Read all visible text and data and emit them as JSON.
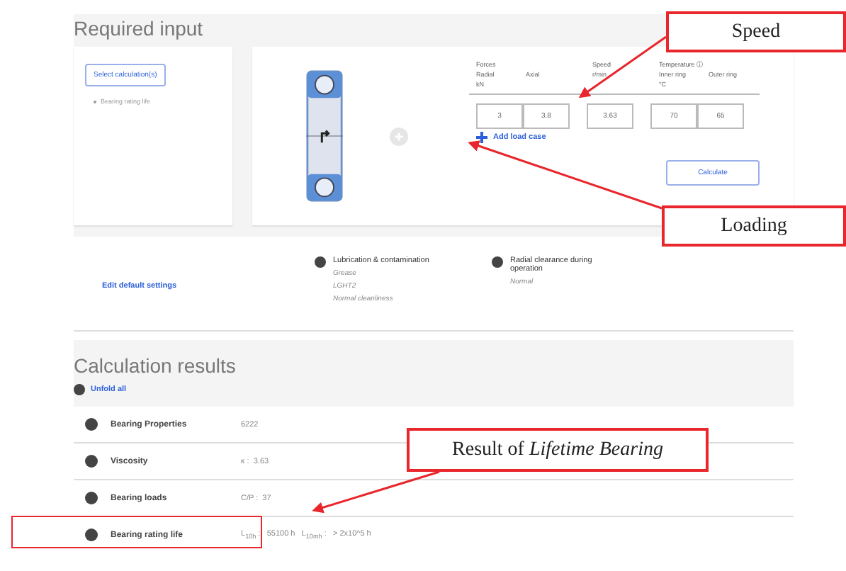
{
  "required_input": {
    "title": "Required input",
    "select_button": "Select calculation(s)",
    "selected_calculations": [
      "Bearing rating life"
    ],
    "load_table": {
      "groups": [
        {
          "label": "Forces",
          "columns": [
            {
              "label": "Radial",
              "unit": "kN",
              "value": "3"
            },
            {
              "label": "Axial",
              "value": "3.8"
            }
          ]
        },
        {
          "label": "Speed",
          "columns": [
            {
              "unit": "r/min",
              "value": "3.63"
            }
          ]
        },
        {
          "label": "Temperature ⓘ",
          "columns": [
            {
              "label": "Inner ring",
              "unit": "°C",
              "value": "70"
            },
            {
              "label": "Outer ring",
              "value": "65"
            }
          ]
        }
      ]
    },
    "add_load_case": "Add load case",
    "calculate_button": "Calculate"
  },
  "settings": {
    "edit_link": "Edit default settings",
    "groups": [
      {
        "title": "Lubrication & contamination",
        "values": [
          "Grease",
          "LGHT2",
          "Normal cleanliness"
        ]
      },
      {
        "title": "Radial clearance during operation",
        "values": [
          "Normal"
        ]
      }
    ]
  },
  "results": {
    "title": "Calculation results",
    "unfold": "Unfold all",
    "rows": [
      {
        "label": "Bearing Properties",
        "value": "6222",
        "highlighted": false
      },
      {
        "label": "Viscosity",
        "value": "κ :  3.63",
        "highlighted": false
      },
      {
        "label": "Bearing loads",
        "value": "C/P :  37",
        "highlighted": false
      },
      {
        "label": "Bearing rating life",
        "value": "L$_{10h}$ :   55100 h   L$_{10mh}$ :   > 2x10^5 h",
        "highlighted": true
      }
    ]
  },
  "annotations": [
    {
      "kind": "plain",
      "text": "Speed"
    },
    {
      "kind": "plain",
      "text": "Loading"
    },
    {
      "kind": "rich",
      "text": "Result of *Lifetime Bearing*"
    }
  ]
}
